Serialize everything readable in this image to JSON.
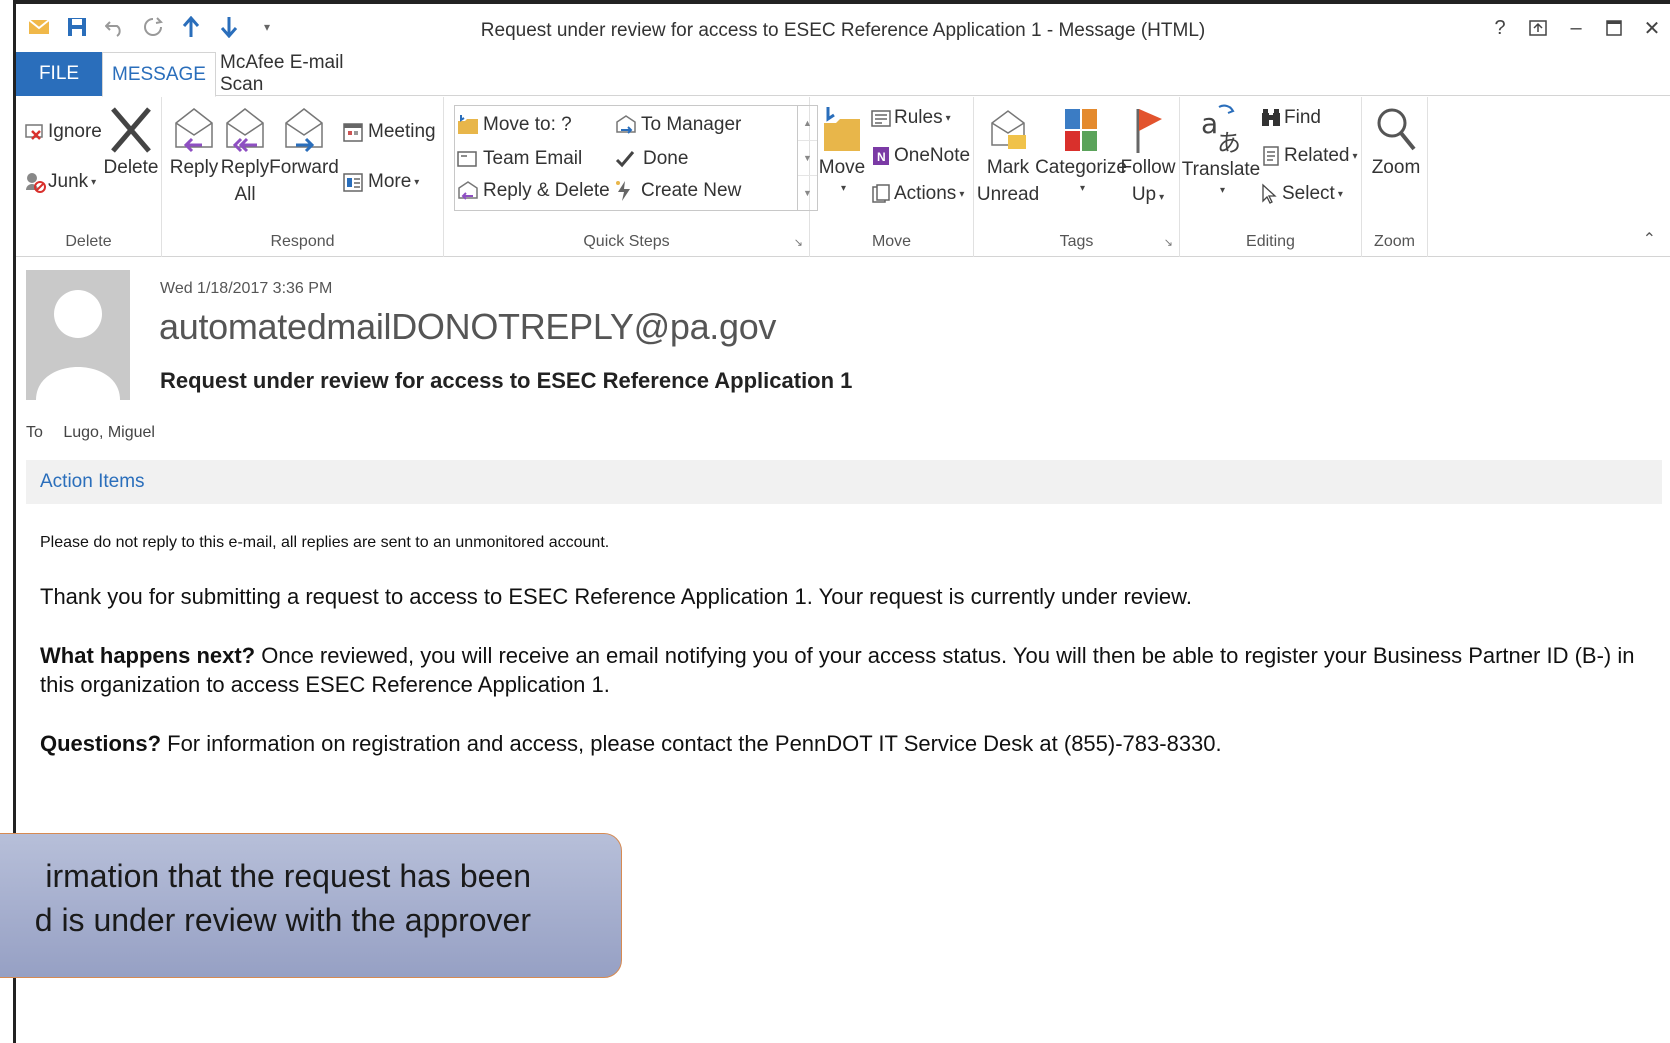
{
  "window": {
    "title": "Request under review for access to ESEC Reference Application 1 - Message (HTML)",
    "controls": [
      "?",
      "restore-ribbon",
      "minimize",
      "maximize",
      "close"
    ]
  },
  "tabs": [
    {
      "label": "FILE"
    },
    {
      "label": "MESSAGE"
    },
    {
      "label": "McAfee E-mail Scan"
    }
  ],
  "ribbon": {
    "delete": {
      "label": "Delete",
      "ignore": "Ignore",
      "junk": "Junk",
      "delete": "Delete"
    },
    "respond": {
      "label": "Respond",
      "reply": "Reply",
      "reply_all_1": "Reply",
      "reply_all_2": "All",
      "forward": "Forward",
      "meeting": "Meeting",
      "more": "More"
    },
    "quick_steps": {
      "label": "Quick Steps",
      "move_to": "Move to: ?",
      "team_email": "Team Email",
      "reply_delete": "Reply & Delete",
      "to_manager": "To Manager",
      "done": "Done",
      "create_new": "Create New"
    },
    "move": {
      "label": "Move",
      "move": "Move",
      "rules": "Rules",
      "onenote": "OneNote",
      "actions": "Actions"
    },
    "tags": {
      "label": "Tags",
      "mark_unread_1": "Mark",
      "mark_unread_2": "Unread",
      "categorize": "Categorize",
      "follow_up_1": "Follow",
      "follow_up_2": "Up"
    },
    "editing": {
      "label": "Editing",
      "translate": "Translate",
      "find": "Find",
      "related": "Related",
      "select": "Select"
    },
    "zoom": {
      "label": "Zoom",
      "zoom": "Zoom"
    }
  },
  "message": {
    "date": "Wed 1/18/2017 3:36 PM",
    "sender": "automatedmailDONOTREPLY@pa.gov",
    "subject": "Request under review for access to ESEC Reference Application 1",
    "to_label": "To",
    "to_value": "Lugo, Miguel",
    "action_items": "Action Items",
    "body": {
      "p1": "Please do not reply to this e-mail, all replies are sent to an unmonitored account.",
      "p2": "Thank you for submitting a request to access to ESEC Reference Application 1. Your request is currently under review.",
      "p3_bold": "What happens next?",
      "p3_rest": " Once reviewed, you will receive an email notifying you of your access status.  You will then be able to register your Business Partner ID (B-) in this organization to access ESEC Reference Application 1.",
      "p4_bold": "Questions?",
      "p4_rest": " For information on registration and access, please contact the PennDOT IT Service Desk at (855)-783-8330."
    }
  },
  "callout": {
    "line1": "irmation that the request has been",
    "line2": "d is under review with the approver"
  }
}
